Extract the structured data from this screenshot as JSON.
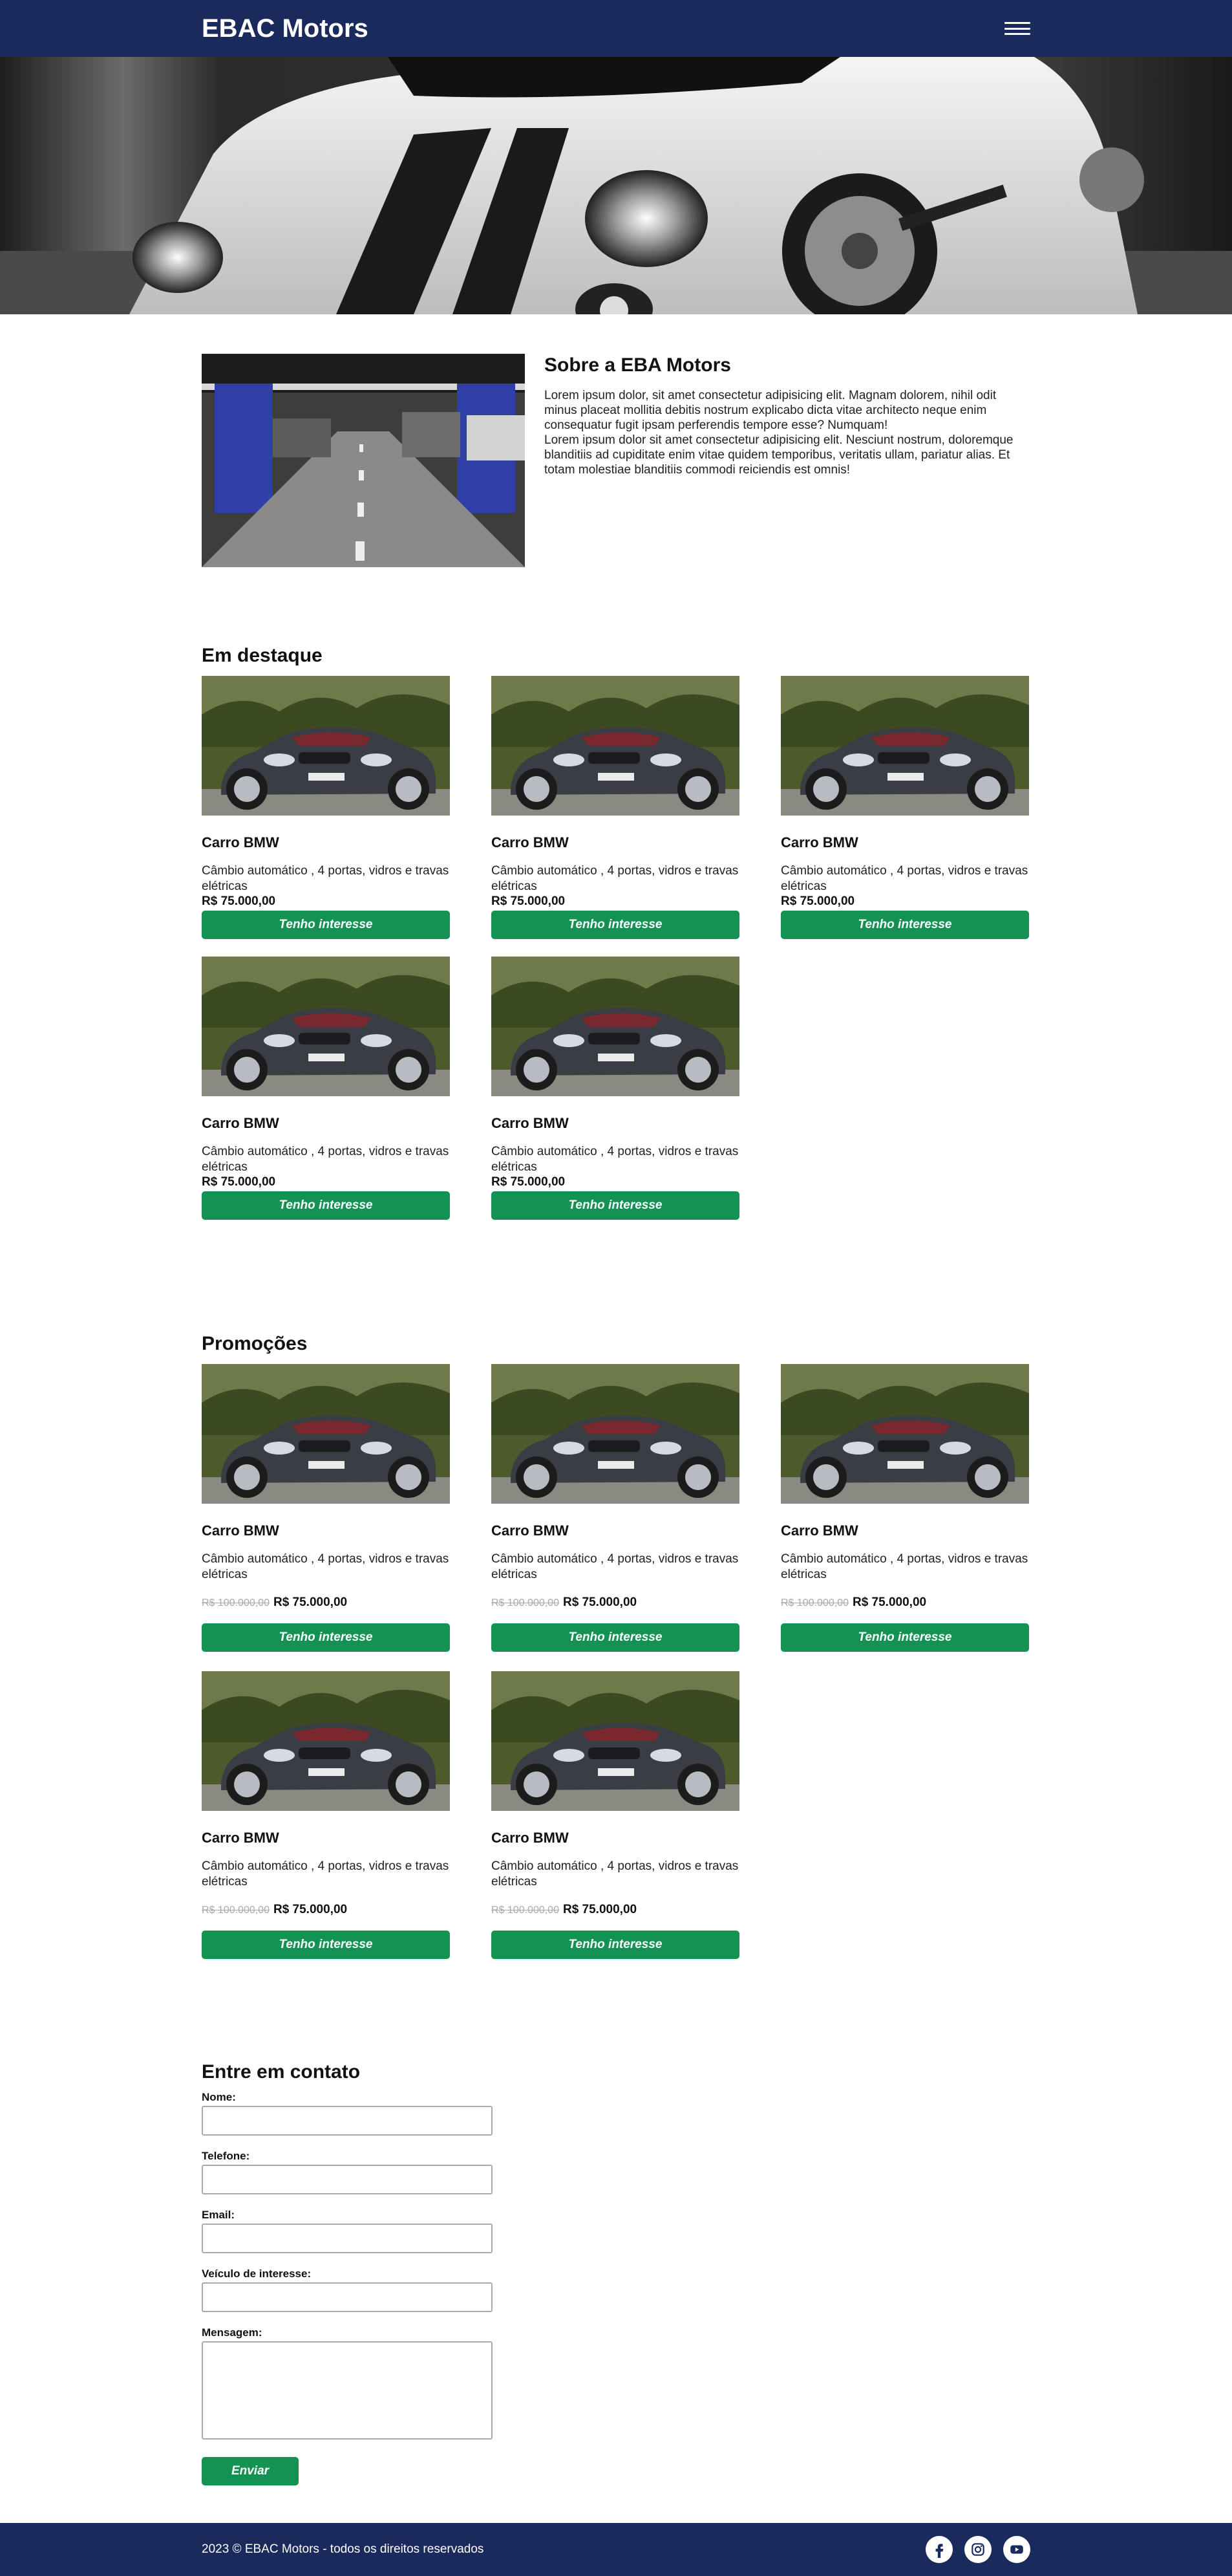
{
  "header": {
    "logo": "EBAC Motors",
    "menu_icon": "hamburger-menu-icon"
  },
  "hero": {
    "image": "sports-car-banner"
  },
  "about": {
    "title": "Sobre a EBA Motors",
    "paragraph_1": "Lorem ipsum dolor, sit amet consectetur adipisicing elit. Magnam dolorem, nihil odit minus placeat mollitia debitis nostrum explicabo dicta vitae architecto neque enim consequatur fugit ipsam perferendis tempore esse? Numquam!",
    "paragraph_2": "Lorem ipsum dolor sit amet consectetur adipisicing elit. Nesciunt nostrum, doloremque blanditiis ad cupiditate enim vitae quidem temporibus, veritatis ullam, pariatur alias. Et totam molestiae blanditiis commodi reiciendis est omnis!"
  },
  "featured": {
    "title": "Em destaque",
    "items": [
      {
        "title": "Carro BMW",
        "desc": "Câmbio automático , 4 portas, vidros e travas elétricas",
        "price": "R$ 75.000,00",
        "button": "Tenho interesse"
      },
      {
        "title": "Carro BMW",
        "desc": "Câmbio automático , 4 portas, vidros e travas elétricas",
        "price": "R$ 75.000,00",
        "button": "Tenho interesse"
      },
      {
        "title": "Carro BMW",
        "desc": "Câmbio automático , 4 portas, vidros e travas elétricas",
        "price": "R$ 75.000,00",
        "button": "Tenho interesse"
      },
      {
        "title": "Carro BMW",
        "desc": "Câmbio automático , 4 portas, vidros e travas elétricas",
        "price": "R$ 75.000,00",
        "button": "Tenho interesse"
      },
      {
        "title": "Carro BMW",
        "desc": "Câmbio automático , 4 portas, vidros e travas elétricas",
        "price": "R$ 75.000,00",
        "button": "Tenho interesse"
      }
    ]
  },
  "promo": {
    "title": "Promoções",
    "items": [
      {
        "title": "Carro BMW",
        "desc": "Câmbio automático , 4 portas, vidros e travas elétricas",
        "old_price": "R$ 100.000,00",
        "price": "R$ 75.000,00",
        "button": "Tenho interesse"
      },
      {
        "title": "Carro BMW",
        "desc": "Câmbio automático , 4 portas, vidros e travas elétricas",
        "old_price": "R$ 100.000,00",
        "price": "R$ 75.000,00",
        "button": "Tenho interesse"
      },
      {
        "title": "Carro BMW",
        "desc": "Câmbio automático , 4 portas, vidros e travas elétricas",
        "old_price": "R$ 100.000,00",
        "price": "R$ 75.000,00",
        "button": "Tenho interesse"
      },
      {
        "title": "Carro BMW",
        "desc": "Câmbio automático , 4 portas, vidros e travas elétricas",
        "old_price": "R$ 100.000,00",
        "price": "R$ 75.000,00",
        "button": "Tenho interesse"
      },
      {
        "title": "Carro BMW",
        "desc": "Câmbio automático , 4 portas, vidros e travas elétricas",
        "old_price": "R$ 100.000,00",
        "price": "R$ 75.000,00",
        "button": "Tenho interesse"
      }
    ]
  },
  "contact": {
    "title": "Entre em contato",
    "fields": [
      {
        "label": "Nome:",
        "type": "input",
        "value": ""
      },
      {
        "label": "Telefone:",
        "type": "input",
        "value": ""
      },
      {
        "label": "Email:",
        "type": "input",
        "value": ""
      },
      {
        "label": "Veículo de interesse:",
        "type": "input",
        "value": ""
      },
      {
        "label": "Mensagem:",
        "type": "textarea",
        "value": ""
      }
    ],
    "submit": "Enviar"
  },
  "footer": {
    "text": "2023 © EBAC Motors - todos os direitos reservados",
    "socials": [
      "facebook-icon",
      "instagram-icon",
      "youtube-icon"
    ]
  },
  "colors": {
    "navy": "#1b2a5c",
    "green": "#149254"
  }
}
